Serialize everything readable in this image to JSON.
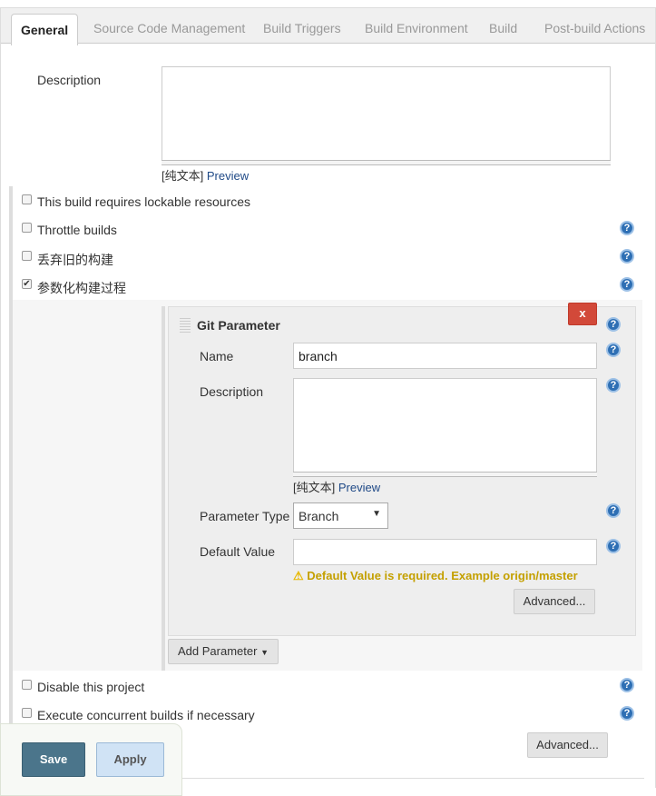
{
  "tabs": [
    {
      "label": "General"
    },
    {
      "label": "Source Code Management"
    },
    {
      "label": "Build Triggers"
    },
    {
      "label": "Build Environment"
    },
    {
      "label": "Build"
    },
    {
      "label": "Post-build Actions"
    }
  ],
  "description": {
    "label": "Description",
    "value": "",
    "format": "[纯文本]",
    "preview": "Preview"
  },
  "options": [
    {
      "label": "This build requires lockable resources",
      "checked": false
    },
    {
      "label": "Throttle builds",
      "checked": false
    },
    {
      "label": "丢弃旧的构建",
      "checked": false
    },
    {
      "label": "参数化构建过程",
      "checked": true
    }
  ],
  "git_parameter": {
    "title": "Git Parameter",
    "delete_label": "x",
    "name_label": "Name",
    "name_value": "branch",
    "desc_label": "Description",
    "desc_format": "[纯文本]",
    "desc_preview": "Preview",
    "type_label": "Parameter Type",
    "type_value": "Branch",
    "default_label": "Default Value",
    "default_value": "",
    "warning": "Default Value is required. Example origin/master",
    "advanced": "Advanced..."
  },
  "add_parameter": "Add Parameter",
  "options2": [
    {
      "label": "Disable this project",
      "checked": false
    },
    {
      "label": "Execute concurrent builds if necessary",
      "checked": false
    }
  ],
  "advanced": "Advanced...",
  "footer": {
    "save": "Save",
    "apply": "Apply"
  },
  "colors": {
    "save": "#4b758b",
    "apply": "#d0e3f5",
    "delete": "#d24939",
    "warning": "#c4a000"
  }
}
